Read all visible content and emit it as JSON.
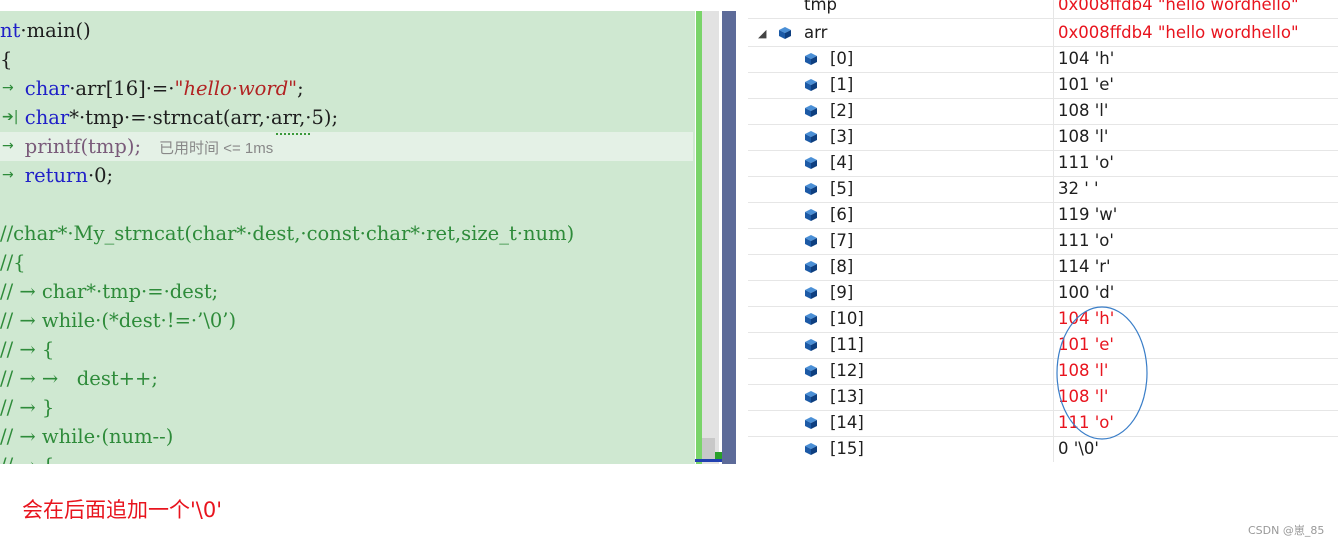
{
  "editor": {
    "lines": [
      {
        "segs": [
          {
            "t": "nt",
            "c": "kw"
          },
          {
            "t": "·main()",
            "c": ""
          }
        ]
      },
      {
        "segs": [
          {
            "t": "{",
            "c": ""
          }
        ]
      },
      {
        "arrow": "→",
        "segs": [
          {
            "t": "    ",
            "c": ""
          },
          {
            "t": "char",
            "c": "kw"
          },
          {
            "t": "·arr[16]·=·",
            "c": ""
          },
          {
            "t": "\"hello·word\"",
            "c": "str"
          },
          {
            "t": ";",
            "c": ""
          }
        ]
      },
      {
        "arrow": "➔|",
        "segs": [
          {
            "t": "    ",
            "c": ""
          },
          {
            "t": "char",
            "c": "kw"
          },
          {
            "t": "*·tmp·=·strncat(arr,·arr,·5);",
            "c": ""
          }
        ]
      },
      {
        "arrow": "→",
        "segs": [
          {
            "t": "    printf(tmp);",
            "c": "pr"
          }
        ],
        "inline": "已用时间 <= 1ms"
      },
      {
        "arrow": "→",
        "segs": [
          {
            "t": "    ",
            "c": ""
          },
          {
            "t": "return",
            "c": "kw"
          },
          {
            "t": "·0;",
            "c": ""
          }
        ]
      },
      {
        "segs": []
      },
      {
        "segs": [
          {
            "t": "//char*·My_strncat(char*·dest,·const·char*·ret,size_t·num)",
            "c": "cm"
          }
        ]
      },
      {
        "segs": [
          {
            "t": "//{",
            "c": "cm"
          }
        ]
      },
      {
        "segs": [
          {
            "t": "// → char*·tmp·=·dest;",
            "c": "cm"
          }
        ]
      },
      {
        "segs": [
          {
            "t": "// → while·(*dest·!=·’\\0’)",
            "c": "cm"
          }
        ]
      },
      {
        "segs": [
          {
            "t": "// → {",
            "c": "cm"
          }
        ]
      },
      {
        "segs": [
          {
            "t": "// → →   dest++;",
            "c": "cm"
          }
        ]
      },
      {
        "segs": [
          {
            "t": "// → }",
            "c": "cm"
          }
        ]
      },
      {
        "segs": [
          {
            "t": "// → while·(num--)",
            "c": "cm"
          }
        ]
      },
      {
        "segs": [
          {
            "t": "// → {",
            "c": "cm"
          }
        ]
      }
    ]
  },
  "watch": {
    "top_partial": {
      "name": "tmp",
      "value": "0x008ffdb4 \"hello wordhello\""
    },
    "parent": {
      "name": "arr",
      "value": "0x008ffdb4 \"hello wordhello\""
    },
    "items": [
      {
        "name": "[0]",
        "value": "104 'h'",
        "highlight": false
      },
      {
        "name": "[1]",
        "value": "101 'e'",
        "highlight": false
      },
      {
        "name": "[2]",
        "value": "108 'l'",
        "highlight": false
      },
      {
        "name": "[3]",
        "value": "108 'l'",
        "highlight": false
      },
      {
        "name": "[4]",
        "value": "111 'o'",
        "highlight": false
      },
      {
        "name": "[5]",
        "value": "32 ' '",
        "highlight": false
      },
      {
        "name": "[6]",
        "value": "119 'w'",
        "highlight": false
      },
      {
        "name": "[7]",
        "value": "111 'o'",
        "highlight": false
      },
      {
        "name": "[8]",
        "value": "114 'r'",
        "highlight": false
      },
      {
        "name": "[9]",
        "value": "100 'd'",
        "highlight": false
      },
      {
        "name": "[10]",
        "value": "104 'h'",
        "highlight": true
      },
      {
        "name": "[11]",
        "value": "101 'e'",
        "highlight": true
      },
      {
        "name": "[12]",
        "value": "108 'l'",
        "highlight": true
      },
      {
        "name": "[13]",
        "value": "108 'l'",
        "highlight": true
      },
      {
        "name": "[14]",
        "value": "111 'o'",
        "highlight": true
      },
      {
        "name": "[15]",
        "value": "0 '\\0'",
        "highlight": false
      }
    ],
    "icon": "cube-icon"
  },
  "caption": "会在后面追加一个'\\0'",
  "credit": "CSDN @崽_85",
  "colors": {
    "editor_bg": "#cfe8d1",
    "changed_value": "#e8141e",
    "annotation": "#3a7ec8"
  }
}
